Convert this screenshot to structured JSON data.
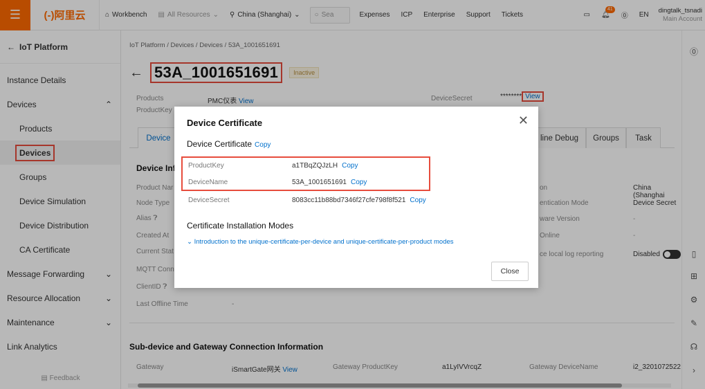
{
  "topbar": {
    "logo": "(-)阿里云",
    "workbench": "Workbench",
    "all_resources": "All Resources",
    "region": "China (Shanghai)",
    "search_placeholder": "Sea",
    "links": [
      "Expenses",
      "ICP",
      "Enterprise",
      "Support",
      "Tickets"
    ],
    "notification_count": "41",
    "language": "EN",
    "account_name": "dingtalk_tsnadi",
    "account_sub": "Main Account"
  },
  "sidebar": {
    "back_label": "IoT Platform",
    "items": [
      {
        "label": "Instance Details"
      },
      {
        "label": "Devices"
      },
      {
        "label": "Products"
      },
      {
        "label": "Devices"
      },
      {
        "label": "Groups"
      },
      {
        "label": "Device Simulation"
      },
      {
        "label": "Device Distribution"
      },
      {
        "label": "CA Certificate"
      },
      {
        "label": "Message Forwarding"
      },
      {
        "label": "Resource Allocation"
      },
      {
        "label": "Maintenance"
      },
      {
        "label": "Link Analytics"
      }
    ],
    "feedback": "Feedback"
  },
  "main": {
    "breadcrumb": [
      "IoT Platform",
      "Devices",
      "Devices",
      "53A_1001651691"
    ],
    "title": "53A_1001651691",
    "status": "Inactive",
    "products_label": "Products",
    "products_value": "PMC仪表",
    "view_label": "View",
    "productkey_label": "ProductKey",
    "devicesecret_label": "DeviceSecret",
    "devicesecret_value": "********",
    "tabs": [
      "Device",
      "line Debug",
      "Groups",
      "Task"
    ],
    "device_info_title": "Device Inf",
    "left_labels": [
      "Product Nar",
      "Node Type",
      "Alias",
      "Created At",
      "Current Stat",
      "MQTT Conn",
      "ClientID",
      "Last Offline Time"
    ],
    "last_offline_value": "-",
    "right_labels": [
      "on",
      "entication Mode",
      "ware Version",
      "Online",
      "ce local log reporting"
    ],
    "right_values": [
      "China (Shanghai",
      "Device Secret",
      "-",
      "-",
      "Disabled"
    ],
    "subdevice_title": "Sub-device and Gateway Connection Information",
    "gateway_label": "Gateway",
    "gateway_value": "iSmartGate网关",
    "gateway_pk_label": "Gateway ProductKey",
    "gateway_pk_value": "a1LyIVVrcqZ",
    "gateway_dn_label": "Gateway DeviceName",
    "gateway_dn_value": "i2_3201072522"
  },
  "modal": {
    "title": "Device Certificate",
    "subtitle": "Device Certificate",
    "copy_label": "Copy",
    "rows": [
      {
        "key": "ProductKey",
        "value": "a1TBqZQJzLH"
      },
      {
        "key": "DeviceName",
        "value": "53A_1001651691"
      },
      {
        "key": "DeviceSecret",
        "value": "8083cc11b88bd7346f27cfe798f8f521"
      }
    ],
    "section": "Certificate Installation Modes",
    "intro_link": "Introduction to the unique-certificate-per-device and unique-certificate-per-product modes",
    "close_button": "Close"
  }
}
